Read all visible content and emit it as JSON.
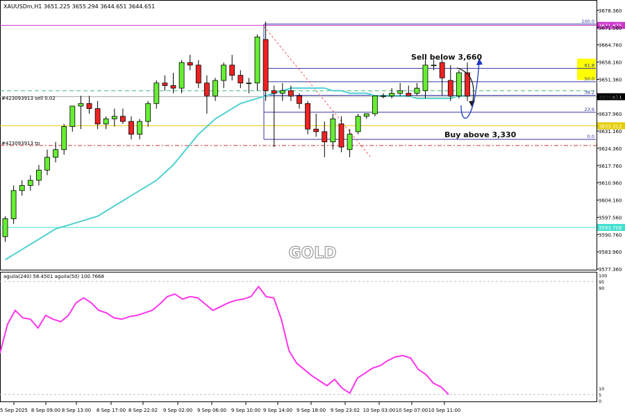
{
  "header": {
    "symbol_info": "XAUUSDm,H1  3651.225 3655.294 3644.651 3644.651",
    "indicator_info": "aguila(240) 58.4501  aguila(50) 100.7668",
    "watermark": "GOLD"
  },
  "annotations": {
    "sell": "Sell below 3,660",
    "buy": "Buy above 3,330",
    "order_sell": "#423093913 sell 0.02",
    "order_tp": "#423093913 tp"
  },
  "fib": {
    "levels": [
      {
        "label": "100.0",
        "price": 3673.0
      },
      {
        "label": "61.8",
        "price": 3655.7
      },
      {
        "label": "50.0",
        "price": 3650.5
      },
      {
        "label": "38.2",
        "price": 3645.2
      },
      {
        "label": "23.6",
        "price": 3638.6
      },
      {
        "label": "0.0",
        "price": 3628.0
      }
    ]
  },
  "hlines": [
    {
      "name": "magenta-level",
      "price": 3672.5,
      "label": "3671.875",
      "color": "#cc33cc",
      "dash": "",
      "label_bg": "#cc33cc"
    },
    {
      "name": "order-open-line",
      "price": 3647.0,
      "label": "",
      "color": "#3cb371",
      "dash": "6,4",
      "label_bg": ""
    },
    {
      "name": "bid-line",
      "price": 3644.651,
      "label": "3644.651",
      "color": "#aaaaaa",
      "dash": "",
      "label_bg": "#000000"
    },
    {
      "name": "yellow-level",
      "price": 3633.3,
      "label": "3633.312",
      "color": "#e5cc00",
      "dash": "",
      "label_bg": "#e5cc00"
    },
    {
      "name": "tp-line",
      "price": 3625.6,
      "label": "",
      "color": "#d03030",
      "dash": "6,3,2,3",
      "label_bg": ""
    },
    {
      "name": "cyan-level",
      "price": 3593.6,
      "label": "3593.708",
      "color": "#40e0d0",
      "dash": "",
      "label_bg": "#40e0d0"
    }
  ],
  "colors": {
    "bull": "#66ee33",
    "bear": "#ee2222",
    "ma": "#50d0d0",
    "oscillator": "#ff33ee",
    "fib": "#3030a0",
    "highlight": "#ffff00"
  },
  "chart_data": [
    {
      "type": "candlestick",
      "title": "XAUUSDm,H1",
      "ylim": [
        3577.36,
        3681.0
      ],
      "price_ticks": [
        "3678.360",
        "3671.560",
        "3664.760",
        "3658.160",
        "3651.360",
        "3644.560",
        "3637.960",
        "3631.160",
        "3624.360",
        "3617.760",
        "3610.960",
        "3604.160",
        "3597.560",
        "3590.760",
        "3583.960",
        "3577.360"
      ],
      "time_labels": [
        "5 Sep 2025",
        "8 Sep 09:00",
        "8 Sep 13:00",
        "8 Sep 17:00",
        "8 Sep 22:02",
        "9 Sep 02:00",
        "9 Sep 06:00",
        "9 Sep 10:00",
        "9 Sep 14:00",
        "9 Sep 18:00",
        "9 Sep 23:02",
        "10 Sep 03:00",
        "10 Sep 07:00",
        "10 Sep 11:00"
      ],
      "candles": [
        {
          "o": 3590.0,
          "h": 3598.0,
          "l": 3588.0,
          "c": 3597.0
        },
        {
          "o": 3597.0,
          "h": 3610.0,
          "l": 3595.0,
          "c": 3608.0
        },
        {
          "o": 3608.0,
          "h": 3612.0,
          "l": 3606.0,
          "c": 3610.0
        },
        {
          "o": 3610.0,
          "h": 3614.0,
          "l": 3608.0,
          "c": 3612.0
        },
        {
          "o": 3612.0,
          "h": 3618.0,
          "l": 3610.0,
          "c": 3616.0
        },
        {
          "o": 3616.0,
          "h": 3624.0,
          "l": 3614.0,
          "c": 3621.0
        },
        {
          "o": 3621.0,
          "h": 3627.0,
          "l": 3619.0,
          "c": 3624.0
        },
        {
          "o": 3624.0,
          "h": 3634.0,
          "l": 3622.0,
          "c": 3633.0
        },
        {
          "o": 3633.0,
          "h": 3641.0,
          "l": 3631.0,
          "c": 3641.0
        },
        {
          "o": 3641.0,
          "h": 3645.0,
          "l": 3632.0,
          "c": 3642.0
        },
        {
          "o": 3642.0,
          "h": 3645.0,
          "l": 3638.0,
          "c": 3640.0
        },
        {
          "o": 3640.0,
          "h": 3643.0,
          "l": 3632.0,
          "c": 3634.0
        },
        {
          "o": 3634.0,
          "h": 3637.0,
          "l": 3632.0,
          "c": 3636.0
        },
        {
          "o": 3636.0,
          "h": 3640.0,
          "l": 3633.0,
          "c": 3637.0
        },
        {
          "o": 3637.0,
          "h": 3640.0,
          "l": 3634.0,
          "c": 3635.0
        },
        {
          "o": 3635.0,
          "h": 3637.0,
          "l": 3628.0,
          "c": 3630.0
        },
        {
          "o": 3630.0,
          "h": 3636.0,
          "l": 3628.0,
          "c": 3635.0
        },
        {
          "o": 3635.0,
          "h": 3643.0,
          "l": 3633.0,
          "c": 3642.0
        },
        {
          "o": 3642.0,
          "h": 3651.0,
          "l": 3640.0,
          "c": 3650.0
        },
        {
          "o": 3650.0,
          "h": 3653.0,
          "l": 3647.0,
          "c": 3649.0
        },
        {
          "o": 3649.0,
          "h": 3654.0,
          "l": 3646.0,
          "c": 3648.0
        },
        {
          "o": 3648.0,
          "h": 3659.0,
          "l": 3646.0,
          "c": 3658.0
        },
        {
          "o": 3658.0,
          "h": 3661.0,
          "l": 3655.0,
          "c": 3657.0
        },
        {
          "o": 3657.0,
          "h": 3659.0,
          "l": 3648.0,
          "c": 3650.0
        },
        {
          "o": 3650.0,
          "h": 3653.0,
          "l": 3638.0,
          "c": 3645.0
        },
        {
          "o": 3645.0,
          "h": 3652.0,
          "l": 3643.0,
          "c": 3651.0
        },
        {
          "o": 3651.0,
          "h": 3658.0,
          "l": 3648.0,
          "c": 3657.0
        },
        {
          "o": 3657.0,
          "h": 3661.0,
          "l": 3651.0,
          "c": 3653.0
        },
        {
          "o": 3653.0,
          "h": 3655.0,
          "l": 3648.0,
          "c": 3650.0
        },
        {
          "o": 3650.0,
          "h": 3652.0,
          "l": 3646.0,
          "c": 3650.0
        },
        {
          "o": 3650.0,
          "h": 3669.0,
          "l": 3647.0,
          "c": 3668.0
        },
        {
          "o": 3667.0,
          "h": 3674.0,
          "l": 3643.0,
          "c": 3647.0
        },
        {
          "o": 3647.0,
          "h": 3649.0,
          "l": 3625.0,
          "c": 3646.0
        },
        {
          "o": 3646.0,
          "h": 3650.0,
          "l": 3643.0,
          "c": 3647.0
        },
        {
          "o": 3647.0,
          "h": 3649.0,
          "l": 3643.0,
          "c": 3645.0
        },
        {
          "o": 3645.0,
          "h": 3646.0,
          "l": 3640.0,
          "c": 3642.0
        },
        {
          "o": 3642.0,
          "h": 3643.0,
          "l": 3630.0,
          "c": 3632.0
        },
        {
          "o": 3632.0,
          "h": 3638.0,
          "l": 3629.0,
          "c": 3631.0
        },
        {
          "o": 3631.0,
          "h": 3635.0,
          "l": 3621.0,
          "c": 3627.0
        },
        {
          "o": 3627.0,
          "h": 3638.0,
          "l": 3624.0,
          "c": 3636.0
        },
        {
          "o": 3634.0,
          "h": 3637.0,
          "l": 3623.0,
          "c": 3625.0
        },
        {
          "o": 3624.0,
          "h": 3632.0,
          "l": 3621.0,
          "c": 3630.0
        },
        {
          "o": 3631.0,
          "h": 3638.0,
          "l": 3630.0,
          "c": 3637.0
        },
        {
          "o": 3637.0,
          "h": 3638.0,
          "l": 3636.0,
          "c": 3638.0
        },
        {
          "o": 3638.0,
          "h": 3645.0,
          "l": 3637.0,
          "c": 3645.0
        },
        {
          "o": 3645.0,
          "h": 3646.0,
          "l": 3644.0,
          "c": 3645.0
        },
        {
          "o": 3645.0,
          "h": 3648.0,
          "l": 3644.0,
          "c": 3646.0
        },
        {
          "o": 3646.0,
          "h": 3650.0,
          "l": 3645.0,
          "c": 3647.0
        },
        {
          "o": 3646.0,
          "h": 3649.0,
          "l": 3645.0,
          "c": 3645.0
        },
        {
          "o": 3646.0,
          "h": 3650.0,
          "l": 3645.0,
          "c": 3648.0
        },
        {
          "o": 3647.0,
          "h": 3659.0,
          "l": 3644.0,
          "c": 3657.0
        },
        {
          "o": 3657.0,
          "h": 3659.0,
          "l": 3655.0,
          "c": 3657.0
        },
        {
          "o": 3658.0,
          "h": 3659.0,
          "l": 3645.0,
          "c": 3652.0
        },
        {
          "o": 3651.0,
          "h": 3657.0,
          "l": 3643.0,
          "c": 3645.0
        },
        {
          "o": 3645.0,
          "h": 3655.0,
          "l": 3644.0,
          "c": 3654.0
        },
        {
          "o": 3654.0,
          "h": 3658.0,
          "l": 3643.0,
          "c": 3645.0
        }
      ],
      "moving_average": [
        3581,
        3583,
        3585,
        3587,
        3589,
        3591,
        3593,
        3594,
        3595,
        3596,
        3597,
        3598,
        3600,
        3602,
        3604,
        3606,
        3608,
        3610,
        3612,
        3615,
        3618,
        3622,
        3626,
        3630,
        3633,
        3636,
        3638,
        3640,
        3642,
        3643,
        3644,
        3645,
        3646,
        3647,
        3648,
        3648,
        3648,
        3648,
        3648,
        3647,
        3647,
        3646,
        3646,
        3646,
        3645,
        3645,
        3645,
        3645,
        3645,
        3644,
        3644,
        3644,
        3644,
        3644,
        3645,
        3645
      ]
    },
    {
      "type": "line",
      "title": "aguila(240) 58.4501 aguila(50) 100.7668",
      "ylim": [
        0,
        100
      ],
      "y_ticks": [
        100,
        95,
        90,
        10,
        5,
        0
      ],
      "series": [
        {
          "values": [
            38,
            61,
            72,
            66,
            65,
            58,
            68,
            65,
            63,
            68,
            78,
            82,
            78,
            72,
            70,
            66,
            65,
            67,
            68,
            70,
            72,
            77,
            83,
            85,
            81,
            83,
            82,
            77,
            72,
            75,
            78,
            80,
            81,
            83,
            91,
            83,
            82,
            65,
            40,
            30,
            25,
            20,
            16,
            12,
            17,
            10,
            6,
            18,
            22,
            26,
            28,
            32,
            35,
            36,
            34,
            25,
            21,
            14,
            11,
            5
          ]
        }
      ]
    }
  ]
}
